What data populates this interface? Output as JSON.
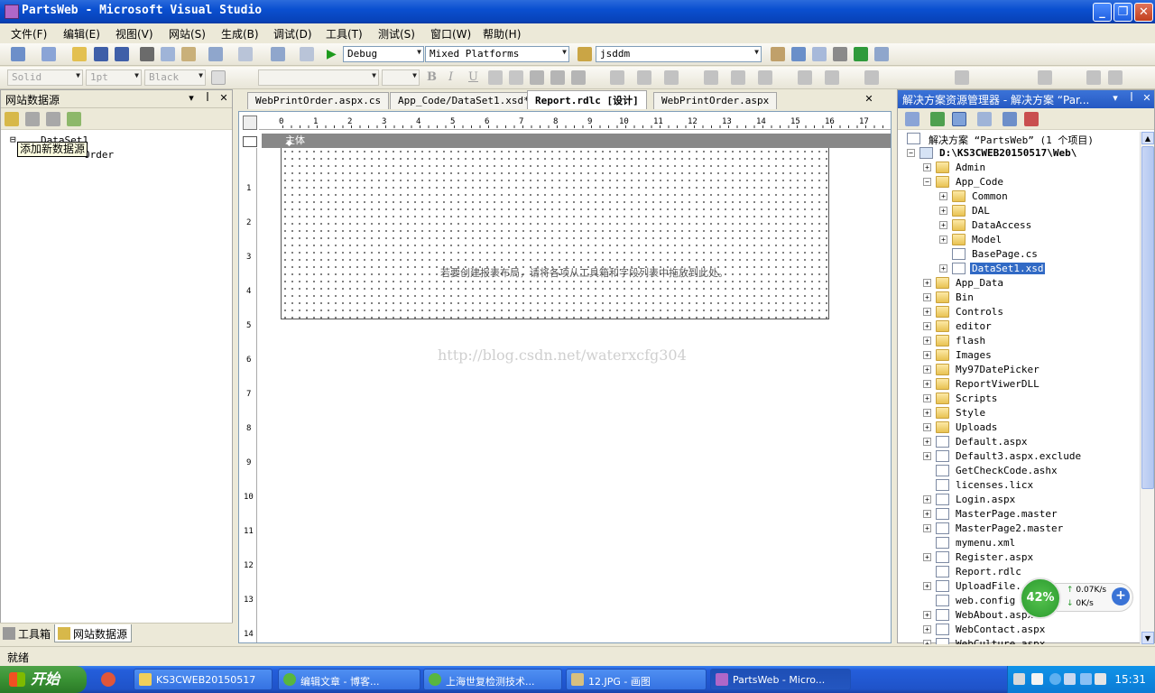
{
  "window": {
    "title": "PartsWeb - Microsoft Visual Studio",
    "buttons": {
      "minimize": "_",
      "maximize": "❐",
      "close": "✕"
    }
  },
  "menu": [
    "文件(F)",
    "编辑(E)",
    "视图(V)",
    "网站(S)",
    "生成(B)",
    "调试(D)",
    "工具(T)",
    "测试(S)",
    "窗口(W)",
    "帮助(H)"
  ],
  "toolbar1": {
    "config": "Debug",
    "platform": "Mixed Platforms",
    "find_value": "jsddm"
  },
  "toolbar2": {
    "line_style": "Solid",
    "line_width": "1pt",
    "line_color": "Black",
    "bold": "B",
    "italic": "I",
    "underline": "U"
  },
  "left_panel": {
    "title": "网站数据源",
    "tree": {
      "root": "DataSet1",
      "child": "Order"
    },
    "tooltip": "添加新数据源",
    "bottom_tabs": [
      "工具箱",
      "网站数据源"
    ]
  },
  "editor": {
    "tabs": [
      "WebPrintOrder.aspx.cs",
      "App_Code/DataSet1.xsd*",
      "Report.rdlc [设计]",
      "WebPrintOrder.aspx"
    ],
    "active_tab": "Report.rdlc [设计]",
    "body_label": "主体",
    "hint": "若要创建报表布局，请将各项从工具箱和字段列表中拖放到此处。",
    "watermark": "http://blog.csdn.net/waterxcfg304",
    "ruler_h": [
      "0",
      "1",
      "2",
      "3",
      "4",
      "5",
      "6",
      "7",
      "8",
      "9",
      "10",
      "11",
      "12",
      "13",
      "14",
      "15",
      "16",
      "17"
    ],
    "ruler_v": [
      "1",
      "2",
      "3",
      "4",
      "5",
      "6",
      "7",
      "8",
      "9",
      "10",
      "11",
      "12",
      "13",
      "14"
    ]
  },
  "solution_explorer": {
    "title": "解决方案资源管理器 - 解决方案 “Par...",
    "solution": "解决方案 “PartsWeb” (1 个项目)",
    "project": "D:\\KS3CWEB20150517\\Web\\",
    "items": [
      {
        "label": "Admin",
        "type": "folder",
        "level": 1,
        "exp": "+"
      },
      {
        "label": "App_Code",
        "type": "folder",
        "level": 1,
        "exp": "-"
      },
      {
        "label": "Common",
        "type": "folder",
        "level": 2,
        "exp": "+"
      },
      {
        "label": "DAL",
        "type": "folder",
        "level": 2,
        "exp": "+"
      },
      {
        "label": "DataAccess",
        "type": "folder",
        "level": 2,
        "exp": "+"
      },
      {
        "label": "Model",
        "type": "folder",
        "level": 2,
        "exp": "+"
      },
      {
        "label": "BasePage.cs",
        "type": "file",
        "level": 2,
        "exp": ""
      },
      {
        "label": "DataSet1.xsd",
        "type": "file",
        "level": 2,
        "exp": "+",
        "selected": true
      },
      {
        "label": "App_Data",
        "type": "folder",
        "level": 1,
        "exp": "+"
      },
      {
        "label": "Bin",
        "type": "folder",
        "level": 1,
        "exp": "+"
      },
      {
        "label": "Controls",
        "type": "folder",
        "level": 1,
        "exp": "+"
      },
      {
        "label": "editor",
        "type": "folder",
        "level": 1,
        "exp": "+"
      },
      {
        "label": "flash",
        "type": "folder",
        "level": 1,
        "exp": "+"
      },
      {
        "label": "Images",
        "type": "folder",
        "level": 1,
        "exp": "+"
      },
      {
        "label": "My97DatePicker",
        "type": "folder",
        "level": 1,
        "exp": "+"
      },
      {
        "label": "ReportViwerDLL",
        "type": "folder",
        "level": 1,
        "exp": "+"
      },
      {
        "label": "Scripts",
        "type": "folder",
        "level": 1,
        "exp": "+"
      },
      {
        "label": "Style",
        "type": "folder",
        "level": 1,
        "exp": "+"
      },
      {
        "label": "Uploads",
        "type": "folder",
        "level": 1,
        "exp": "+"
      },
      {
        "label": "Default.aspx",
        "type": "file",
        "level": 1,
        "exp": "+"
      },
      {
        "label": "Default3.aspx.exclude",
        "type": "file",
        "level": 1,
        "exp": "+"
      },
      {
        "label": "GetCheckCode.ashx",
        "type": "file",
        "level": 1,
        "exp": ""
      },
      {
        "label": "licenses.licx",
        "type": "file",
        "level": 1,
        "exp": ""
      },
      {
        "label": "Login.aspx",
        "type": "file",
        "level": 1,
        "exp": "+"
      },
      {
        "label": "MasterPage.master",
        "type": "file",
        "level": 1,
        "exp": "+"
      },
      {
        "label": "MasterPage2.master",
        "type": "file",
        "level": 1,
        "exp": "+"
      },
      {
        "label": "mymenu.xml",
        "type": "file",
        "level": 1,
        "exp": ""
      },
      {
        "label": "Register.aspx",
        "type": "file",
        "level": 1,
        "exp": "+"
      },
      {
        "label": "Report.rdlc",
        "type": "file",
        "level": 1,
        "exp": ""
      },
      {
        "label": "UploadFile.",
        "type": "file",
        "level": 1,
        "exp": "+"
      },
      {
        "label": "web.config",
        "type": "file",
        "level": 1,
        "exp": ""
      },
      {
        "label": "WebAbout.aspx",
        "type": "file",
        "level": 1,
        "exp": "+"
      },
      {
        "label": "WebContact.aspx",
        "type": "file",
        "level": 1,
        "exp": "+"
      },
      {
        "label": "WebCulture.aspx",
        "type": "file",
        "level": 1,
        "exp": "+"
      }
    ]
  },
  "net_widget": {
    "percent": "42%",
    "upload": "0.07K/s",
    "download": "0K/s",
    "plus": "+"
  },
  "status": {
    "text": "就绪"
  },
  "taskbar": {
    "start": "开始",
    "tasks": [
      "KS3CWEB20150517",
      "编辑文章 - 博客...",
      "上海世复检测技术...",
      "12.JPG - 画图",
      "PartsWeb - Micro..."
    ],
    "clock": "15:31"
  },
  "colors": {
    "title_bar": "#0a4fd0",
    "selection": "#316ac5",
    "taskbar": "#245edb",
    "start_button": "#3a9234",
    "net_ring": "#2a9a2e"
  }
}
